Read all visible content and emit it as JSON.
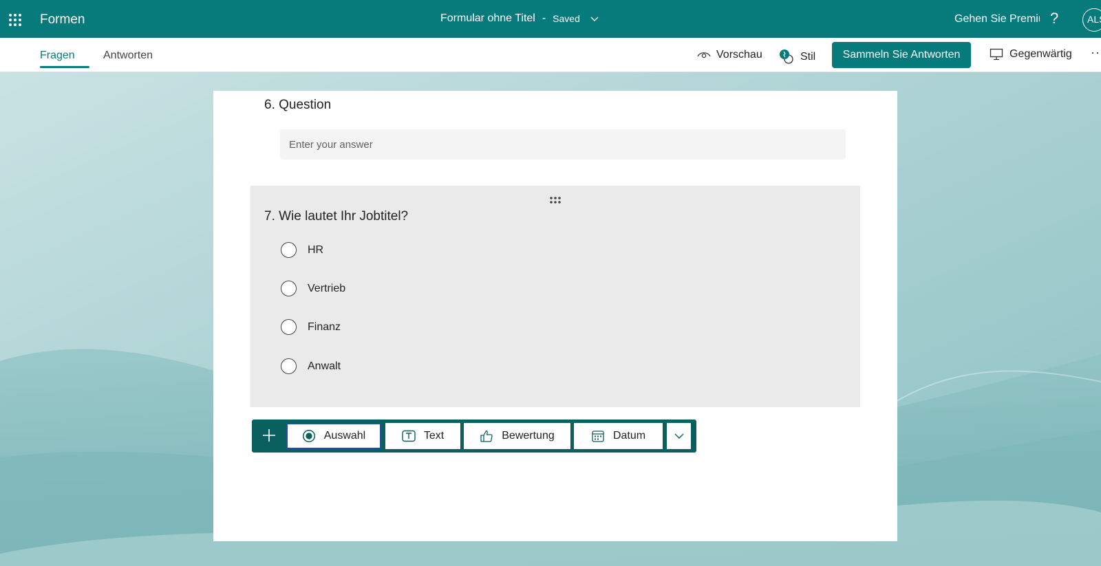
{
  "topbar": {
    "app_name": "Formen",
    "doc_title": "Formular ohne Titel",
    "separator": "-",
    "save_status": "Saved",
    "premium_label": "Gehen Sie Premium",
    "help_label": "?",
    "avatar_initials": "ALS"
  },
  "subbar": {
    "tabs": [
      {
        "label": "Fragen",
        "active": true
      },
      {
        "label": "Antworten",
        "active": false
      }
    ],
    "preview_label": "Vorschau",
    "style_label": "Stil",
    "collect_label": "Sammeln Sie Antworten",
    "present_label": "Gegenwärtig",
    "more_label": "···"
  },
  "form": {
    "question6": {
      "title": "6. Question",
      "placeholder": "Enter your answer"
    },
    "question7": {
      "title": "7. Wie lautet Ihr Jobtitel?",
      "options": [
        "HR",
        "Vertrieb",
        "Finanz",
        "Anwalt"
      ]
    },
    "add_toolbar": {
      "choice_label": "Auswahl",
      "text_label": "Text",
      "rating_label": "Bewertung",
      "date_label": "Datum"
    }
  },
  "colors": {
    "brand": "#077a7c",
    "toolbar": "#0a5f5f",
    "selected_border": "#1f4fa8"
  }
}
